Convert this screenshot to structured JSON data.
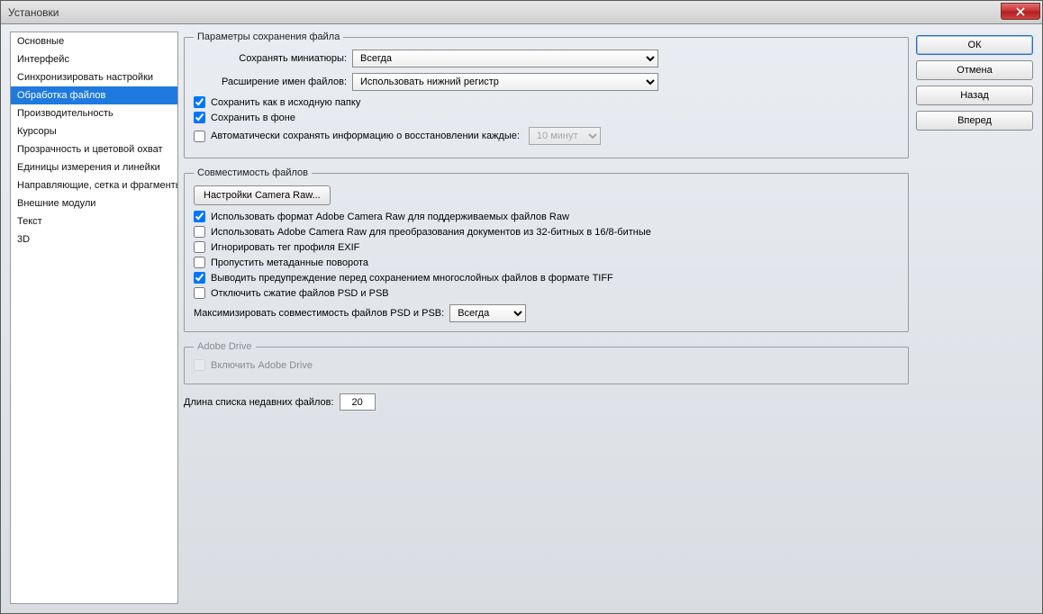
{
  "window": {
    "title": "Установки"
  },
  "sidebar": {
    "items": [
      "Основные",
      "Интерфейс",
      "Синхронизировать настройки",
      "Обработка файлов",
      "Производительность",
      "Курсоры",
      "Прозрачность и цветовой охват",
      "Единицы измерения и линейки",
      "Направляющие, сетка и фрагменты",
      "Внешние модули",
      "Текст",
      "3D"
    ],
    "selected_index": 3
  },
  "buttons": {
    "ok": "ОК",
    "cancel": "Отмена",
    "back": "Назад",
    "forward": "Вперед"
  },
  "sections": {
    "file_save": {
      "legend": "Параметры сохранения файла",
      "thumbnails_label": "Сохранять миниатюры:",
      "thumbnails_value": "Всегда",
      "ext_label": "Расширение имен файлов:",
      "ext_value": "Использовать нижний регистр",
      "save_original_folder": {
        "checked": true,
        "label": "Сохранить как в исходную папку"
      },
      "save_background": {
        "checked": true,
        "label": "Сохранить в фоне"
      },
      "autosave": {
        "checked": false,
        "label": "Автоматически сохранять информацию о восстановлении каждые:",
        "interval": "10 минут"
      }
    },
    "compat": {
      "legend": "Совместимость файлов",
      "camera_raw_btn": "Настройки Camera Raw...",
      "cb1": {
        "checked": true,
        "label": "Использовать формат Adobe Camera Raw для поддерживаемых файлов Raw"
      },
      "cb2": {
        "checked": false,
        "label": "Использовать Adobe Camera Raw для преобразования документов из 32-битных в 16/8-битные"
      },
      "cb3": {
        "checked": false,
        "label": "Игнорировать тег профиля EXIF"
      },
      "cb4": {
        "checked": false,
        "label": "Пропустить метаданные поворота"
      },
      "cb5": {
        "checked": true,
        "label": "Выводить предупреждение перед сохранением многослойных файлов в формате TIFF"
      },
      "cb6": {
        "checked": false,
        "label": "Отключить сжатие файлов PSD и PSB"
      },
      "maxcompat_label": "Максимизировать совместимость файлов PSD и PSB:",
      "maxcompat_value": "Всегда"
    },
    "adobe_drive": {
      "legend": "Adobe Drive",
      "cb": {
        "checked": false,
        "label": "Включить Adobe Drive"
      }
    },
    "recent": {
      "label": "Длина списка недавних файлов:",
      "value": "20"
    }
  }
}
